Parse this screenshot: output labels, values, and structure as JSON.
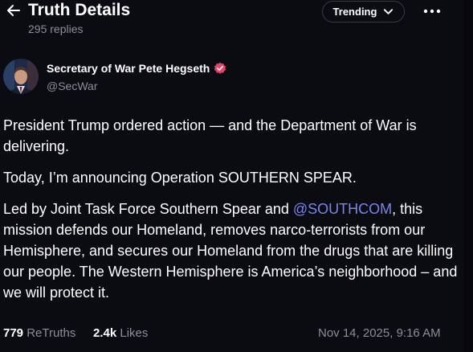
{
  "header": {
    "title": "Truth Details",
    "replies": "295 replies",
    "sort_label": "Trending"
  },
  "icons": {
    "back": "arrow-left-icon",
    "sort": "chevron-down-icon",
    "more": "more-horizontal-icon",
    "verified": "verified-badge-icon"
  },
  "author": {
    "name": "Secretary of War Pete Hegseth",
    "handle": "@SecWar"
  },
  "post": {
    "paragraph_1": "President Trump ordered action — and the Department of War is delivering.",
    "paragraph_2": "Today, I’m announcing Operation SOUTHERN SPEAR.",
    "paragraph_3_before": "Led by Joint Task Force Southern Spear and ",
    "paragraph_3_mention": "@SOUTHCOM",
    "paragraph_3_after": ", this mission defends our Homeland, removes narco-terrorists from our Hemisphere, and secures our Homeland from the drugs that are killing our people. The Western Hemisphere is America’s neighborhood – and we will protect it."
  },
  "stats": {
    "retruths_count": "779",
    "retruths_label": "ReTruths",
    "likes_count": "2.4k",
    "likes_label": "Likes",
    "timestamp": "Nov 14, 2025, 9:16 AM"
  },
  "colors": {
    "background": "#0b0b12",
    "muted_text": "#8e8c9a",
    "mention": "#7b84f0",
    "verified": "#e8436b"
  }
}
